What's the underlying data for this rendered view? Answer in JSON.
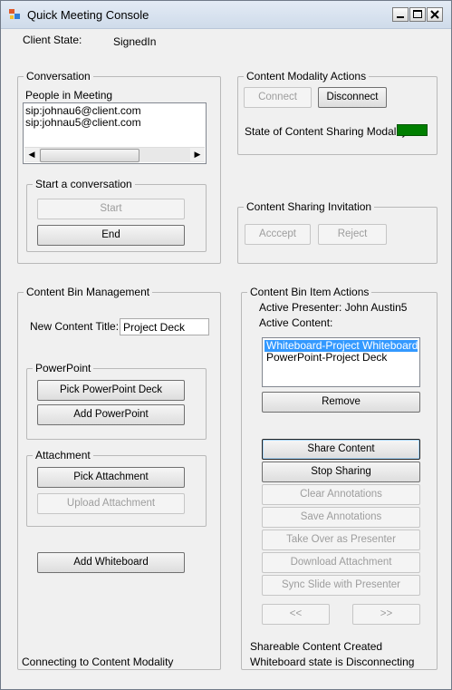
{
  "window": {
    "title": "Quick Meeting Console"
  },
  "client_state": {
    "label": "Client State:",
    "value": "SignedIn"
  },
  "conversation": {
    "legend": "Conversation",
    "people_label": "People in Meeting",
    "people": [
      "sip:johnau6@client.com",
      "sip:johnau5@client.com"
    ],
    "start_group": {
      "legend": "Start a conversation",
      "start_label": "Start",
      "end_label": "End"
    }
  },
  "modality_actions": {
    "legend": "Content Modality Actions",
    "connect_label": "Connect",
    "disconnect_label": "Disconnect",
    "state_label": "State of Content Sharing Modality",
    "state_color": "#007f00"
  },
  "invitation": {
    "legend": "Content Sharing Invitation",
    "accept_label": "Acccept",
    "reject_label": "Reject"
  },
  "bin_management": {
    "legend": "Content Bin Management",
    "title_label": "New Content Title:",
    "title_value": "Project Deck",
    "powerpoint": {
      "legend": "PowerPoint",
      "pick_label": "Pick PowerPoint Deck",
      "add_label": "Add PowerPoint"
    },
    "attachment": {
      "legend": "Attachment",
      "pick_label": "Pick Attachment",
      "upload_label": "Upload Attachment"
    },
    "whiteboard_label": "Add Whiteboard",
    "status": "Connecting to Content Modality"
  },
  "item_actions": {
    "legend": "Content Bin Item Actions",
    "presenter_label": "Active Presenter: John Austin5",
    "content_label": "Active Content:",
    "items": [
      "Whiteboard-Project Whiteboard",
      "PowerPoint-Project Deck"
    ],
    "remove_label": "Remove",
    "share_label": "Share Content",
    "stop_label": "Stop Sharing",
    "clear_label": "Clear Annotations",
    "save_label": "Save Annotations",
    "takeover_label": "Take Over as Presenter",
    "download_label": "Download Attachment",
    "sync_label": "Sync Slide with Presenter",
    "prev_label": "<<",
    "next_label": ">>",
    "status1": "Shareable Content Created",
    "status2": "Whiteboard state is Disconnecting"
  }
}
